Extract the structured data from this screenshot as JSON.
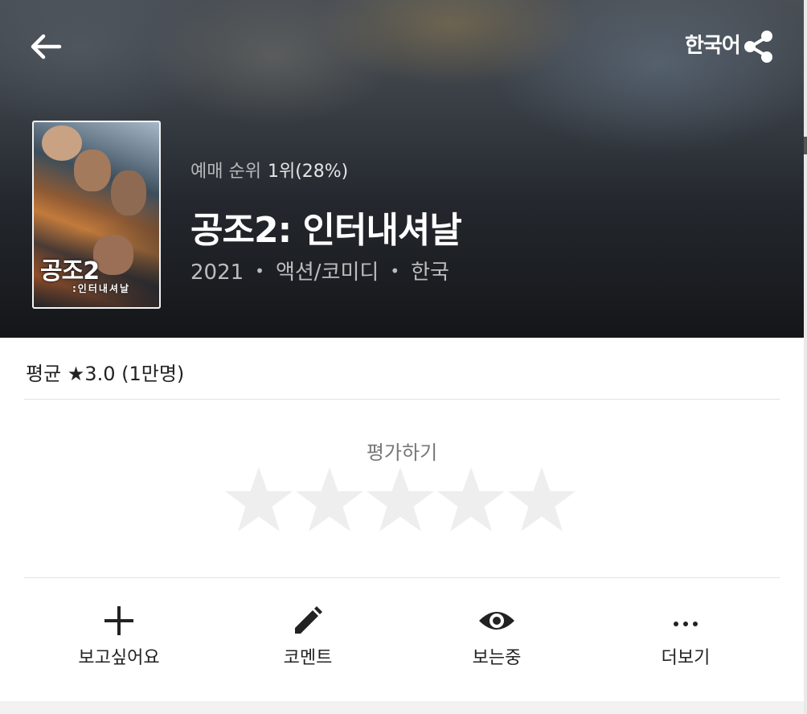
{
  "header": {
    "language_label": "한국어"
  },
  "poster": {
    "title_text": "공조2",
    "subtitle_text": ":인터내셔날"
  },
  "movie": {
    "rank_label": "예매 순위",
    "rank_value": "1위(28%)",
    "title": "공조2: 인터내셔날",
    "year": "2021",
    "genre": "액션/코미디",
    "country": "한국",
    "separator": "•"
  },
  "rating": {
    "average_text": "평균 ★3.0 (1만명)",
    "rate_label": "평가하기",
    "stars_total": 5,
    "stars_selected": 0,
    "star_empty_color": "#eeeeee"
  },
  "actions": [
    {
      "label": "보고싶어요",
      "icon": "plus-icon"
    },
    {
      "label": "코멘트",
      "icon": "pencil-icon"
    },
    {
      "label": "보는중",
      "icon": "eye-icon"
    },
    {
      "label": "더보기",
      "icon": "more-dots-icon"
    }
  ]
}
